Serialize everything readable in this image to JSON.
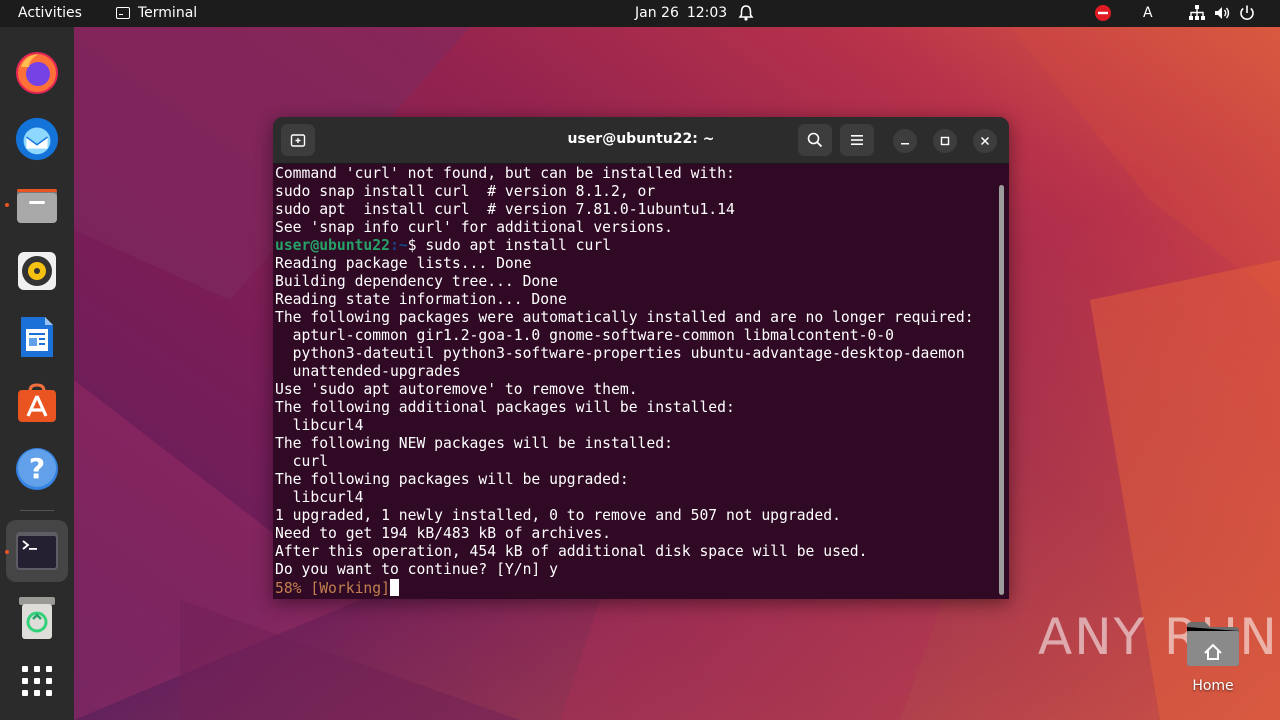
{
  "topbar": {
    "activities_label": "Activities",
    "app_name": "Terminal",
    "date": "Jan 26",
    "time": "12:03",
    "keyboard_layout": "A"
  },
  "dock": {
    "items": [
      {
        "name": "firefox",
        "icon": "firefox-icon"
      },
      {
        "name": "thunderbird",
        "icon": "thunderbird-icon"
      },
      {
        "name": "files",
        "icon": "files-icon"
      },
      {
        "name": "rhythmbox",
        "icon": "rhythmbox-icon"
      },
      {
        "name": "libreoffice-writer",
        "icon": "writer-icon"
      },
      {
        "name": "app-center",
        "icon": "app-center-icon"
      },
      {
        "name": "help",
        "icon": "help-icon"
      },
      {
        "name": "terminal",
        "icon": "terminal-icon"
      },
      {
        "name": "trash",
        "icon": "trash-icon"
      },
      {
        "name": "show-apps",
        "icon": "app-grid-icon"
      }
    ]
  },
  "window": {
    "title": "user@ubuntu22: ~"
  },
  "terminal": {
    "lines": [
      "Command 'curl' not found, but can be installed with:",
      "sudo snap install curl  # version 8.1.2, or",
      "sudo apt  install curl  # version 7.81.0-1ubuntu1.14",
      "See 'snap info curl' for additional versions."
    ],
    "prompt_user": "user@ubuntu22",
    "prompt_path": ":~",
    "prompt_command": "$ sudo apt install curl",
    "output": [
      "Reading package lists... Done",
      "Building dependency tree... Done",
      "Reading state information... Done",
      "The following packages were automatically installed and are no longer required:",
      "  apturl-common gir1.2-goa-1.0 gnome-software-common libmalcontent-0-0",
      "  python3-dateutil python3-software-properties ubuntu-advantage-desktop-daemon",
      "  unattended-upgrades",
      "Use 'sudo apt autoremove' to remove them.",
      "The following additional packages will be installed:",
      "  libcurl4",
      "The following NEW packages will be installed:",
      "  curl",
      "The following packages will be upgraded:",
      "  libcurl4",
      "1 upgraded, 1 newly installed, 0 to remove and 507 not upgraded.",
      "Need to get 194 kB/483 kB of archives.",
      "After this operation, 454 kB of additional disk space will be used.",
      "Do you want to continue? [Y/n] y"
    ],
    "progress": "58% [Working]"
  },
  "desktop": {
    "home_label": "Home",
    "watermark": "ANY RUN"
  }
}
